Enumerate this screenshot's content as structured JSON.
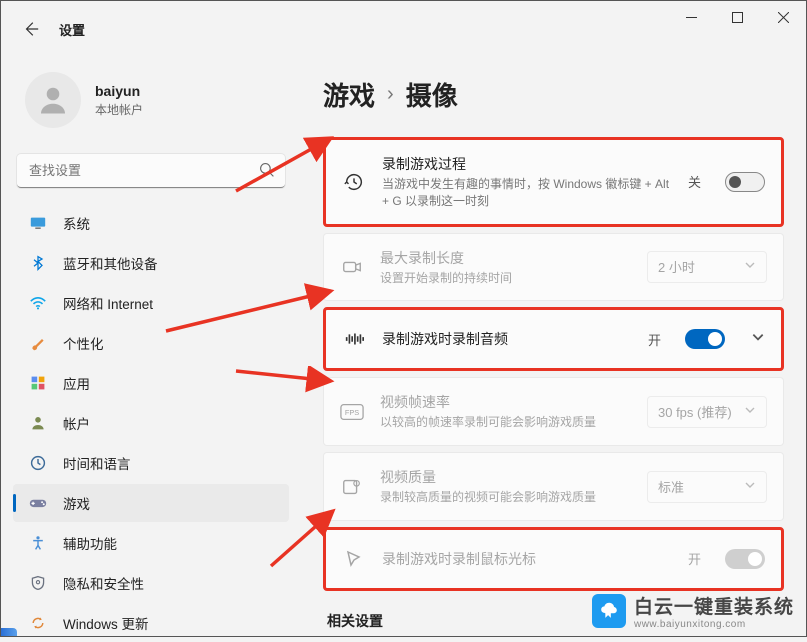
{
  "window": {
    "app_title": "设置"
  },
  "profile": {
    "name": "baiyun",
    "subtitle": "本地帐户"
  },
  "search": {
    "placeholder": "查找设置"
  },
  "sidebar": {
    "items": [
      {
        "label": "系统",
        "icon": "monitor"
      },
      {
        "label": "蓝牙和其他设备",
        "icon": "bluetooth"
      },
      {
        "label": "网络和 Internet",
        "icon": "wifi"
      },
      {
        "label": "个性化",
        "icon": "brush"
      },
      {
        "label": "应用",
        "icon": "apps"
      },
      {
        "label": "帐户",
        "icon": "person"
      },
      {
        "label": "时间和语言",
        "icon": "clock"
      },
      {
        "label": "游戏",
        "icon": "gamepad"
      },
      {
        "label": "辅助功能",
        "icon": "accessibility"
      },
      {
        "label": "隐私和安全性",
        "icon": "shield"
      },
      {
        "label": "Windows 更新",
        "icon": "update"
      }
    ],
    "selected_index": 7
  },
  "breadcrumb": {
    "parent": "游戏",
    "current": "摄像"
  },
  "settings": {
    "record_happened": {
      "title": "录制游戏过程",
      "sub": "当游戏中发生有趣的事情时，按 Windows 徽标键 + Alt + G 以录制这一时刻",
      "state_label": "关",
      "state": "off"
    },
    "max_length": {
      "title": "最大录制长度",
      "sub": "设置开始录制的持续时间",
      "value": "2 小时"
    },
    "record_audio": {
      "title": "录制游戏时录制音频",
      "state_label": "开",
      "state": "on"
    },
    "fps": {
      "title": "视频帧速率",
      "sub": "以较高的帧速率录制可能会影响游戏质量",
      "value": "30 fps (推荐)"
    },
    "quality": {
      "title": "视频质量",
      "sub": "录制较高质量的视频可能会影响游戏质量",
      "value": "标准"
    },
    "capture_cursor": {
      "title": "录制游戏时录制鼠标光标",
      "state_label": "开",
      "state": "on"
    }
  },
  "related": {
    "title": "相关设置"
  },
  "watermark": {
    "line1": "白云一键重装系统",
    "line2": "www.baiyunxitong.com"
  }
}
